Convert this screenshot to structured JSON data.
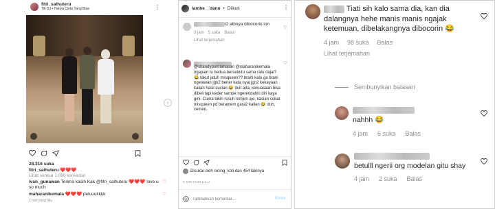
{
  "post": {
    "username": "fitri_salhuteru",
    "music": "Titi DJ • Hanya Cinta Yang Bisa",
    "likes": "28.316 suka",
    "caption_user": "fitri_salhuteru",
    "caption_text": "❤️❤️❤️",
    "view_comments": "Lihat semua 1.090 komentar",
    "comments": [
      {
        "user": "ivan_gunawan",
        "text": "Terima kasih  Kak @fitri_salhuteru ❤️❤️❤️ love u so much"
      },
      {
        "user": "maharanikemala",
        "text": "❤️❤️❤️ peluuukkkk"
      }
    ],
    "time": "2 hari yang lalu"
  },
  "thread": {
    "username": "lambe__danu",
    "follow_status": "Diikuti",
    "comment1_text": "t2 albnya dibocorin ion",
    "comment1_time": "3 jam",
    "comment1_likes": "5 suka",
    "comment1_reply": "Balas",
    "comment1_translate": "Lihat terjemahan",
    "comment2_text": "@shandypurnamasari @maharanikemala ngapain lu bedua bersekutu sama ratu dajal? 😂 takut jatuh misqueen?? brarti kalo ga brani ngelawan jgn2 bener kata nyai jgn2 kekayaan kalian hasil cucian 😂 duit ada, kekuasaan bisa dibeli tapi keder sampe ngerendahin diri kaya gini. Cuma bikin rusuh netijen aje, kasian sobat misqueen pd berantem gara2 kalian 😂 duh, cemen.",
    "liked_by": "Disukai oleh nining_koti dan 454 lainnya",
    "time": "5 JAM YANG LALU",
    "add_comment_placeholder": "Tambahkan komentar...",
    "post_label": "Kirim"
  },
  "replies": {
    "main_text": "Tiati sih kalo sama dia, kan dia dalangnya hehe manis manis ngajak ketemuan, dibelakangnya dibocorin 😂",
    "main_time": "4 jam",
    "main_likes": "98 suka",
    "main_reply": "Balas",
    "main_translate": "Lihat terjemahan",
    "hide_replies": "Sembunyikan balasan",
    "reply1_text": "nahhh 😂",
    "reply1_time": "4 jam",
    "reply1_likes": "6 suka",
    "reply1_reply": "Balas",
    "reply2_text": "betulll ngerii org modelan gitu shay",
    "reply2_time": "4 jam",
    "reply2_likes": "2 suka",
    "reply2_reply": "Balas"
  },
  "colors": {
    "like_red": "#ed4956",
    "muted": "#8e8e8e",
    "link": "#00376b"
  }
}
